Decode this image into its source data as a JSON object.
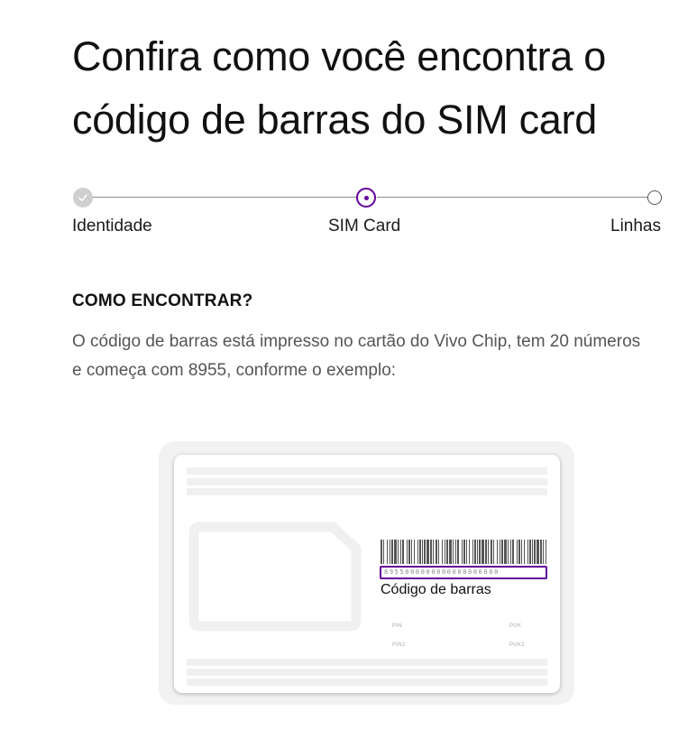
{
  "page": {
    "title": "Confira como você encontra o código de barras do SIM card"
  },
  "stepper": {
    "steps": [
      {
        "label": "Identidade",
        "state": "done"
      },
      {
        "label": "SIM Card",
        "state": "current"
      },
      {
        "label": "Linhas",
        "state": "pending"
      }
    ]
  },
  "section": {
    "heading": "COMO ENCONTRAR?",
    "description": "O código de barras está impresso no cartão do Vivo Chip, tem 20 números e começa com 8955, conforme o exemplo:"
  },
  "card": {
    "barcode_number": "8955000000000000000000",
    "barcode_caption": "Código de barras",
    "labels": {
      "pin": "PIN",
      "puk": "PUK",
      "pin2": "PIN2",
      "puk2": "PUK2"
    }
  },
  "colors": {
    "accent": "#660099",
    "done_step": "#cfcfcf",
    "text_muted": "#555555"
  }
}
